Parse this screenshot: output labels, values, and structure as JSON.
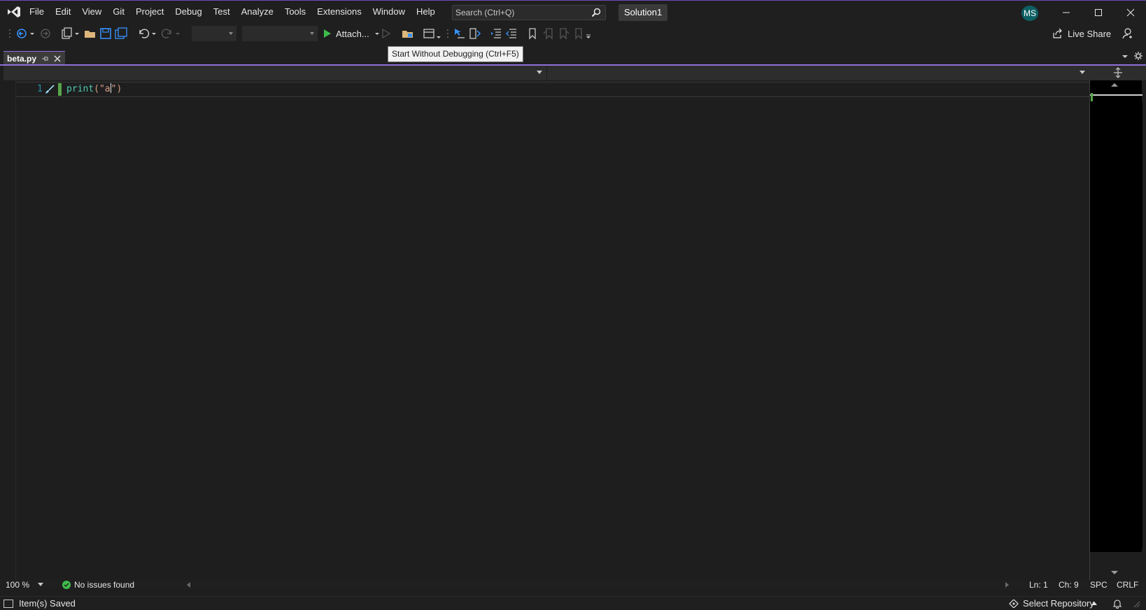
{
  "menu": {
    "items": [
      "File",
      "Edit",
      "View",
      "Git",
      "Project",
      "Debug",
      "Test",
      "Analyze",
      "Tools",
      "Extensions",
      "Window",
      "Help"
    ]
  },
  "search": {
    "placeholder": "Search (Ctrl+Q)"
  },
  "solution": {
    "name": "Solution1"
  },
  "account": {
    "initials": "MS"
  },
  "toolbar": {
    "attach_label": "Attach...",
    "live_share_label": "Live Share",
    "tooltip": "Start Without Debugging (Ctrl+F5)"
  },
  "document": {
    "tab_name": "beta.py",
    "line_number": "1",
    "code": {
      "fn": "print",
      "open": "(\"",
      "str": "a",
      "close": "\")"
    }
  },
  "editor_status": {
    "zoom": "100 %",
    "issues": "No issues found",
    "line": "Ln: 1",
    "char": "Ch: 9",
    "whitespace": "SPC",
    "line_ending": "CRLF"
  },
  "status": {
    "message": "Item(s) Saved",
    "repository": "Select Repository"
  },
  "colors": {
    "accent": "#8f6fd8",
    "run_green": "#3fbc4b",
    "ok_green": "#3fbc4b",
    "avatar_bg": "#0e5f64"
  }
}
